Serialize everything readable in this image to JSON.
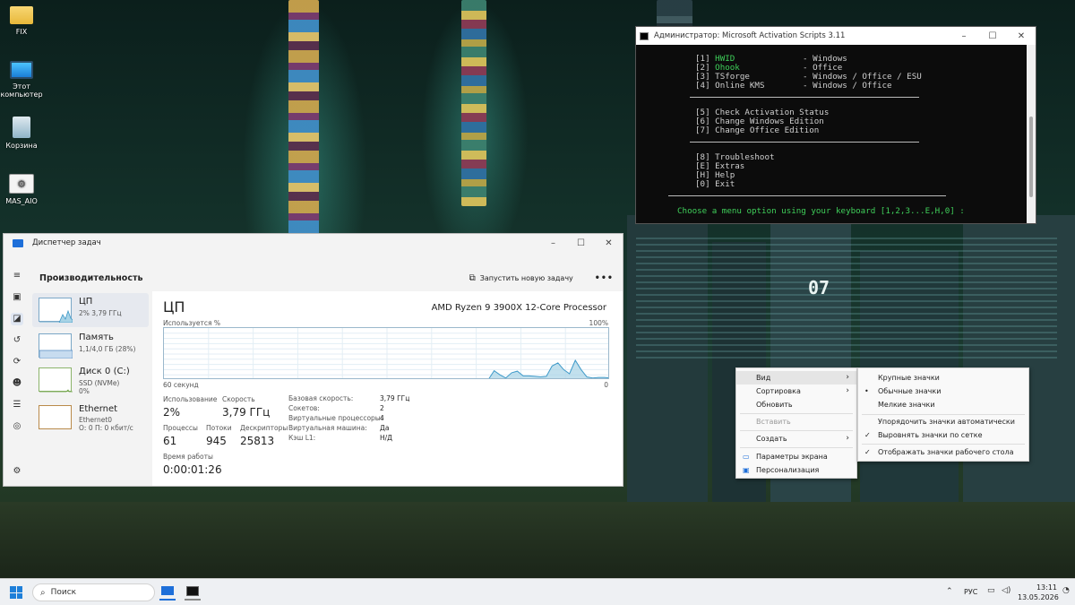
{
  "desktop": {
    "icons": [
      {
        "label": "FIX",
        "icon": "folder-icon"
      },
      {
        "label": "Этот компьютер",
        "icon": "computer-icon"
      },
      {
        "label": "Корзина",
        "icon": "recycle-bin-icon"
      },
      {
        "label": "MAS_AIO",
        "icon": "script-file-icon"
      }
    ],
    "wallpaper_text": "07"
  },
  "cmd": {
    "title": "Администратор:  Microsoft Activation Scripts 3.11",
    "menu": [
      {
        "key": "[1]",
        "name": "HWID",
        "target": "- Windows",
        "highlight": true
      },
      {
        "key": "[2]",
        "name": "Ohook",
        "target": "- Office",
        "highlight": true
      },
      {
        "key": "[3]",
        "name": "TSforge",
        "target": "- Windows / Office / ESU",
        "highlight": false
      },
      {
        "key": "[4]",
        "name": "Online KMS",
        "target": "- Windows / Office",
        "highlight": false
      }
    ],
    "menu2": [
      "[5] Check Activation Status",
      "[6] Change Windows Edition",
      "[7] Change Office Edition"
    ],
    "menu3": [
      "[8] Troubleshoot",
      "[E] Extras",
      "[H] Help",
      "[0] Exit"
    ],
    "prompt": "Choose a menu option using your keyboard [1,2,3...E,H,0] :",
    "controls": [
      "–",
      "☐",
      "✕"
    ]
  },
  "taskmgr": {
    "title": "Диспетчер задач",
    "section": "Производительность",
    "run_task": "Запустить новую задачу",
    "more": "•••",
    "controls": [
      "–",
      "☐",
      "✕"
    ],
    "sidebar": [
      {
        "name": "ЦП",
        "sub1": "2% 3,79 ГГц",
        "sub2": "",
        "selected": true
      },
      {
        "name": "Память",
        "sub1": "1,1/4,0 ГБ (28%)",
        "sub2": "",
        "selected": false
      },
      {
        "name": "Диск 0 (C:)",
        "sub1": "SSD (NVMe)",
        "sub2": "0%",
        "selected": false
      },
      {
        "name": "Ethernet",
        "sub1": "Ethernet0",
        "sub2": "О: 0 П: 0 кбит/с",
        "selected": false
      }
    ],
    "cpu": {
      "heading": "ЦП",
      "model": "AMD Ryzen 9 3900X 12-Core Processor",
      "graph_label": "Используется %",
      "graph_max": "100%",
      "graph_time": "60 секунд",
      "graph_min": "0",
      "stats": {
        "usage_label": "Использование",
        "usage": "2%",
        "speed_label": "Скорость",
        "speed": "3,79 ГГц",
        "processes_label": "Процессы",
        "processes": "61",
        "threads_label": "Потоки",
        "threads": "945",
        "handles_label": "Дескрипторы",
        "handles": "25813",
        "uptime_label": "Время работы",
        "uptime": "0:00:01:26"
      },
      "details": [
        {
          "k": "Базовая скорость:",
          "v": "3,79 ГГц"
        },
        {
          "k": "Сокетов:",
          "v": "2"
        },
        {
          "k": "Виртуальные процессоры:",
          "v": "4"
        },
        {
          "k": "Виртуальная машина:",
          "v": "Да"
        },
        {
          "k": "Кэш L1:",
          "v": "Н/Д"
        }
      ]
    }
  },
  "chart_data": {
    "type": "area",
    "ylabel": "Используется %",
    "ylim": [
      0,
      100
    ],
    "x_range_label": "60 секунд",
    "values": [
      0,
      0,
      0,
      0,
      0,
      0,
      0,
      0,
      0,
      0,
      0,
      0,
      0,
      0,
      0,
      0,
      0,
      0,
      0,
      0,
      0,
      0,
      0,
      0,
      0,
      0,
      0,
      0,
      0,
      0,
      0,
      0,
      0,
      0,
      0,
      0,
      0,
      0,
      0,
      0,
      0,
      0,
      0,
      0,
      0,
      0,
      0,
      0,
      0,
      0,
      0,
      0,
      0,
      1,
      2,
      1,
      1,
      18,
      10,
      4,
      14,
      17,
      8,
      8,
      7,
      6,
      7,
      27,
      33,
      20,
      12,
      38,
      20,
      6,
      4,
      5,
      5,
      4
    ]
  },
  "context_menu": {
    "items": [
      {
        "label": "Вид",
        "submenu": true,
        "highlight": true,
        "disabled": false
      },
      {
        "label": "Сортировка",
        "submenu": true,
        "highlight": false,
        "disabled": false
      },
      {
        "label": "Обновить",
        "submenu": false,
        "highlight": false,
        "disabled": false
      },
      {
        "label": "Вставить",
        "submenu": false,
        "highlight": false,
        "disabled": true
      },
      {
        "label": "Создать",
        "submenu": true,
        "highlight": false,
        "disabled": false
      },
      {
        "label": "Параметры экрана",
        "submenu": false,
        "highlight": false,
        "disabled": false
      },
      {
        "label": "Персонализация",
        "submenu": false,
        "highlight": false,
        "disabled": false
      }
    ]
  },
  "view_submenu": {
    "items": [
      {
        "label": "Крупные значки",
        "mark": ""
      },
      {
        "label": "Обычные значки",
        "mark": "•"
      },
      {
        "label": "Мелкие значки",
        "mark": ""
      },
      {
        "label": "Упорядочить значки автоматически",
        "mark": ""
      },
      {
        "label": "Выровнять значки по сетке",
        "mark": "✓"
      },
      {
        "label": "Отображать значки рабочего стола",
        "mark": "✓"
      }
    ]
  },
  "taskbar": {
    "search_placeholder": "Поиск",
    "lang": "РУС",
    "time": "13:11",
    "date": "13.05.2026"
  },
  "colors": {
    "cmd_green": "#3fcf5a",
    "chart_fill": "#a8d3e6",
    "chart_line": "#3f9ac9",
    "accent": "#1e6fd9"
  }
}
